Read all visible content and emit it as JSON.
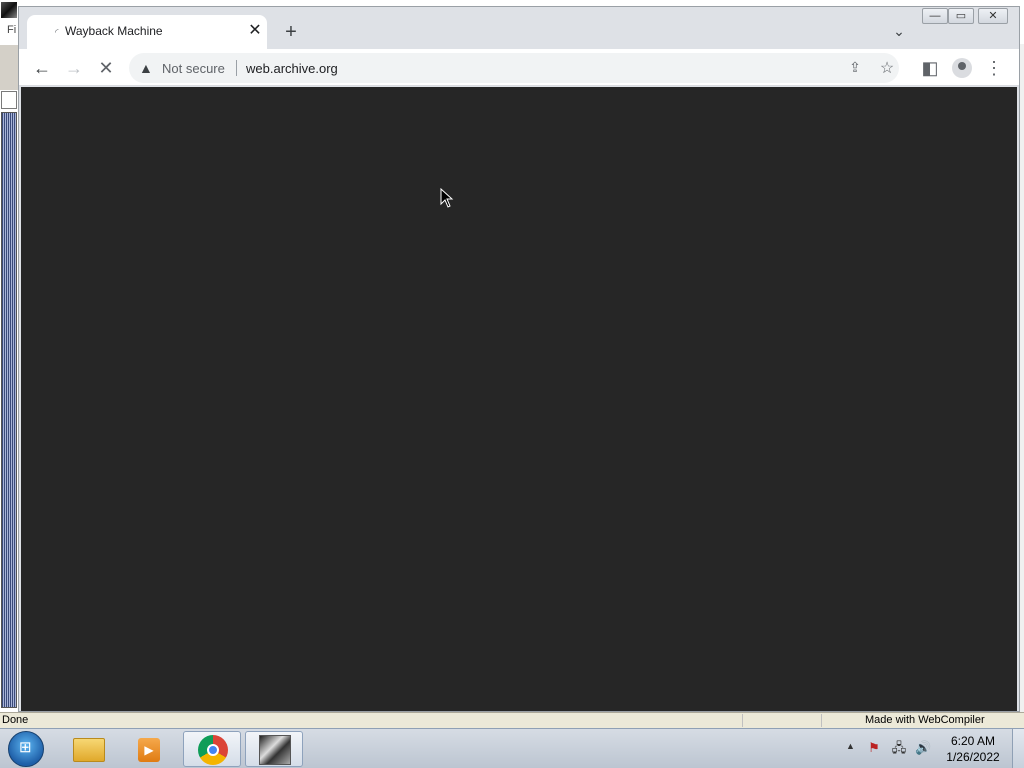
{
  "host": {
    "menu_label": "Fi",
    "status_text": "Done",
    "status_right": "Made with WebCompiler"
  },
  "browser": {
    "tab": {
      "title": "Wayback Machine",
      "close_glyph": "✕",
      "spinner_glyph": "◜"
    },
    "new_tab_glyph": "+",
    "tab_search_glyph": "⌄",
    "window_controls": {
      "minimize": "—",
      "maximize": "▭",
      "close": "✕"
    },
    "nav": {
      "back": "←",
      "forward": "→",
      "stop": "✕"
    },
    "address": {
      "warning_glyph": "▲",
      "security_label": "Not secure",
      "url": "web.archive.org"
    },
    "omni_actions": {
      "share": "⇪",
      "bookmark": "☆"
    },
    "toolbar_actions": {
      "side_panel": "◧",
      "menu": "⋮"
    },
    "page_background": "#262626"
  },
  "taskbar": {
    "start_glyph": "⊞",
    "apps": [
      "explorer",
      "media-player",
      "chrome",
      "legacy-app"
    ],
    "media_glyph": "▶",
    "tray": {
      "arrow": "▲",
      "flag": "⚑",
      "network": "🖧",
      "volume": "🔊"
    },
    "clock": {
      "time": "6:20 AM",
      "date": "1/26/2022"
    }
  }
}
